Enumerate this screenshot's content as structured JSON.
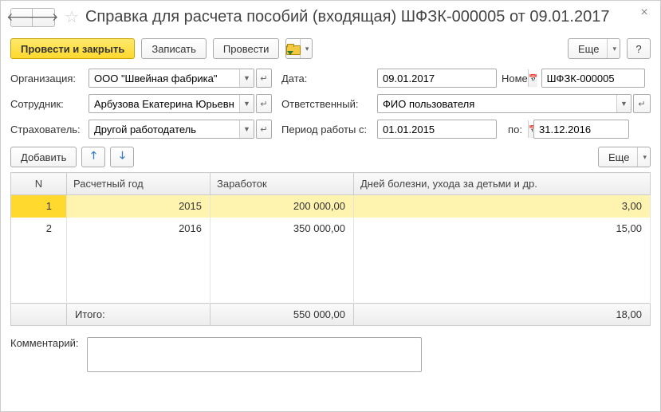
{
  "title": "Справка для расчета пособий (входящая) ШФЗК-000005 от 09.01.2017",
  "toolbar": {
    "post_close": "Провести и закрыть",
    "save": "Записать",
    "post": "Провести",
    "more": "Еще"
  },
  "labels": {
    "org": "Организация:",
    "date": "Дата:",
    "number": "Номер:",
    "employee": "Сотрудник:",
    "responsible": "Ответственный:",
    "insurer": "Страхователь:",
    "period_from": "Период работы с:",
    "period_to": "по:",
    "add": "Добавить",
    "more": "Еще",
    "comment": "Комментарий:"
  },
  "fields": {
    "org": "ООО \"Швейная фабрика\"",
    "date": "09.01.2017",
    "number": "ШФЗК-000005",
    "employee": "Арбузова Екатерина Юрьевна",
    "responsible": "ФИО пользователя",
    "insurer": "Другой работодатель",
    "period_from": "01.01.2015",
    "period_to": "31.12.2016",
    "comment": ""
  },
  "table": {
    "headers": {
      "n": "N",
      "year": "Расчетный год",
      "earn": "Заработок",
      "days": "Дней болезни, ухода за детьми и др."
    },
    "rows": [
      {
        "n": "1",
        "year": "2015",
        "earn": "200 000,00",
        "days": "3,00",
        "selected": true
      },
      {
        "n": "2",
        "year": "2016",
        "earn": "350 000,00",
        "days": "15,00",
        "selected": false
      }
    ],
    "footer": {
      "label": "Итого:",
      "earn": "550 000,00",
      "days": "18,00"
    }
  }
}
